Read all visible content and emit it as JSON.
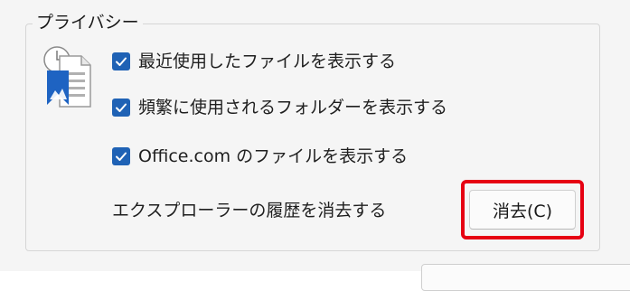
{
  "section": {
    "title": "プライバシー"
  },
  "options": [
    {
      "label": "最近使用したファイルを表示する",
      "checked": true
    },
    {
      "label": "頻繁に使用されるフォルダーを表示する",
      "checked": true
    },
    {
      "label": "Office.com のファイルを表示する",
      "checked": true
    }
  ],
  "clear_history": {
    "label": "エクスプローラーの履歴を消去する",
    "button_label": "消去(C)"
  },
  "colors": {
    "checkbox": "#1f62b5",
    "highlight": "#e60012",
    "background": "#f5f5f5"
  },
  "icons": {
    "privacy": "privacy-document-icon",
    "check": "checkmark-icon"
  }
}
